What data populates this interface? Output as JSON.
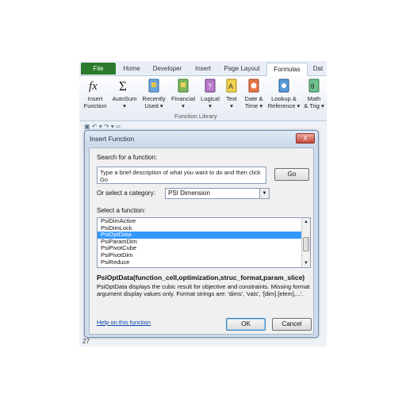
{
  "ribbon_tabs": [
    "File",
    "Home",
    "Developer",
    "Insert",
    "Page Layout",
    "Formulas",
    "Dat"
  ],
  "ribbon_buttons": [
    {
      "label": "Insert\nFunction",
      "icon": "fx-icon"
    },
    {
      "label": "AutoSum\n▾",
      "icon": "sigma-icon"
    },
    {
      "label": "Recently\nUsed ▾",
      "icon": "book-icon"
    },
    {
      "label": "Financial\n▾",
      "icon": "book-icon"
    },
    {
      "label": "Logical\n▾",
      "icon": "book-icon"
    },
    {
      "label": "Text\n▾",
      "icon": "book-icon"
    },
    {
      "label": "Date &\nTime ▾",
      "icon": "book-icon"
    },
    {
      "label": "Lookup &\nReference ▾",
      "icon": "book-icon"
    },
    {
      "label": "Math\n& Trig ▾",
      "icon": "book-icon"
    }
  ],
  "group_label": "Function Library",
  "row_number": "27",
  "dialog": {
    "title": "Insert Function",
    "help_glyph": "?",
    "close_glyph": "X",
    "search_label": "Search for a function:",
    "search_value": "Type a brief description of what you want to do and then click Go",
    "go_label": "Go",
    "category_label": "Or select a category:",
    "category_value": "PSI Dimension",
    "select_label": "Select a function:",
    "functions": [
      "PsiDimActive",
      "PsiDimLock",
      "PsiOptData",
      "PsiParamDim",
      "PsiPivotCube",
      "PsiPivotDim",
      "PsiReduce"
    ],
    "selected_index": 2,
    "signature": "PsiOptData(function_cell,optimization,struc_format,param_slice)",
    "description": "PsiOptData displays the cubic result for objective and constraints. Missing format argument display values only. Format strings are: 'dims', 'vals', '[dim].[elem],...'.",
    "help_link": "Help on this function",
    "ok_label": "OK",
    "cancel_label": "Cancel"
  },
  "colors": {
    "file_tab": "#2c7a2c",
    "selection": "#3399ff",
    "dialog_frame": "#cfdcec"
  }
}
